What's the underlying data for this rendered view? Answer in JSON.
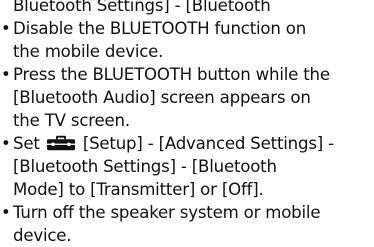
{
  "list": {
    "items": [
      {
        "lines": [
          "Bluetooth Settings] - [Bluetooth"
        ]
      },
      {
        "lines": [
          "Disable the BLUETOOTH function on",
          "the mobile device."
        ]
      },
      {
        "lines": [
          "Press the BLUETOOTH button while the",
          "[Bluetooth Audio] screen appears on",
          "the TV screen."
        ]
      },
      {
        "line1_before_icon": "Set",
        "icon": "toolbox-setup-icon",
        "line1_after_icon": "[Setup] - [Advanced Settings] -",
        "lines": [
          "[Bluetooth Settings] - [Bluetooth",
          "Mode] to [Transmitter] or [Off]."
        ]
      },
      {
        "lines": [
          "Turn off the speaker system or mobile",
          "device."
        ]
      }
    ]
  }
}
